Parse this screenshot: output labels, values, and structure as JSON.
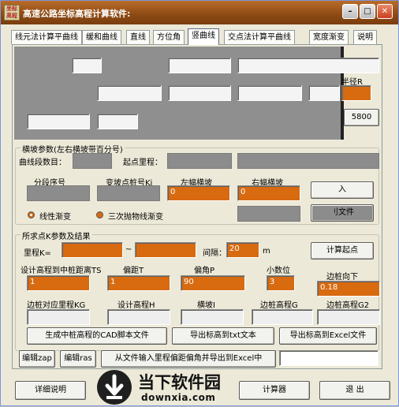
{
  "window": {
    "title": "高速公路坐标高程计算软件:",
    "icon_text": "坐标高程"
  },
  "tabs": [
    "线元法计算平曲线",
    "缓和曲线",
    "直线",
    "方位角",
    "竖曲线",
    "交点法计算平曲线",
    "宽度渐变",
    "说明"
  ],
  "top": {
    "radius_label": "半径R",
    "radius_value": "5800"
  },
  "slope": {
    "title": "横坡参数(左右横坡带百分号)",
    "segment_count_label": "曲线段数目：",
    "start_mileage_label": "起点里程：",
    "seg_no_label": "分段序号",
    "change_pt_label": "变坡点桩号Ki",
    "left_slope_label": "左幅横坡",
    "right_slope_label": "右幅横坡",
    "left_slope_value": "0",
    "right_slope_value": "0",
    "enter_btn": "入",
    "file_btn": "刂文件",
    "radio_linear": "线性渐变",
    "radio_cubic": "三次抛物线渐变"
  },
  "result": {
    "title": "所求点K参数及结果",
    "mileage_label": "里程K=",
    "tilde": "~",
    "interval_label": "间隔：",
    "interval_value": "20",
    "unit_m": "m",
    "calc_start_btn": "计算起点",
    "design_dist_label": "设计高程到中桩距离TS",
    "offset_t_label": "偏距T",
    "angle_p_label": "偏角P",
    "decimals_label": "小数位",
    "edge_down_label": "边桩向下",
    "design_dist_value": "1",
    "offset_t_value": "1",
    "angle_p_value": "90",
    "decimals_value": "3",
    "edge_down_value": "0.18",
    "edge_mileage_label": "边桩对应里程KG",
    "design_h_label": "设计高程H",
    "slope_i_label": "横坡I",
    "edge_g_label": "边桩高程G",
    "edge_g2_label": "边桩高程G2",
    "cad_btn": "生成中桩高程的CAD脚本文件",
    "export_txt_btn": "导出标高到txt文本",
    "export_excel_btn": "导出标高到Excel文件",
    "edit_zap_btn": "编辑zap",
    "edit_ras_btn": "编辑ras",
    "from_file_btn": "从文件输入里程偏距偏角并导出到Excel中"
  },
  "bottom": {
    "detail_btn": "详细说明",
    "calc_btn": "计算器",
    "exit_btn": "退 出"
  },
  "watermark": {
    "text": "当下软件园",
    "url": "downxia.com"
  },
  "colors": {
    "accent": "#d86a10",
    "title": "#8c4a14"
  }
}
